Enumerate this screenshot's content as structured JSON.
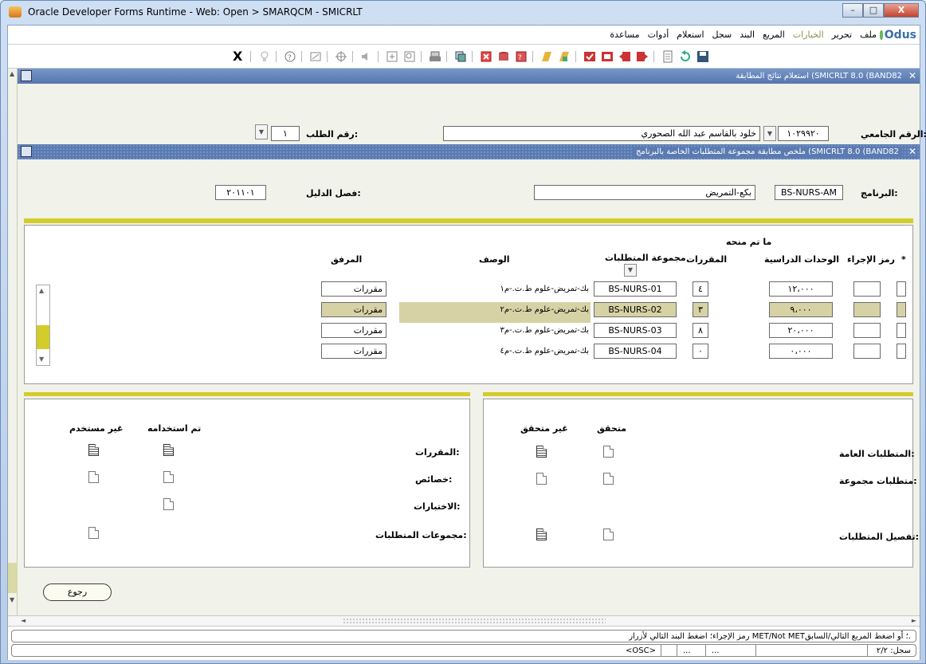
{
  "window": {
    "title": "Oracle Developer Forms Runtime - Web:  Open > SMARQCM - SMICRLT",
    "btn_min": "–",
    "btn_max": "□",
    "btn_close": "X"
  },
  "menu": [
    "ملف",
    "تحرير",
    "الخيارات",
    "المريع",
    "البند",
    "سجل",
    "استعلام",
    "أدوات",
    "مساعدة"
  ],
  "logo": "Odus",
  "toolbar_exit": "X",
  "section1": {
    "title": "استعلام نتائج المطابقة  (SMICRLT 8.0  (BAND82"
  },
  "key": {
    "student_id_label": "الرقم الجامعي:",
    "student_id": "١٠٢٩٩٢٠",
    "student_name": "خلود بالقاسم عبد الله الصحوري",
    "request_label": "رقم الطلب:",
    "request_no": "١"
  },
  "section2": {
    "title": "ملخص مطابقة مجموعة المتطلبات الخاصة بالبرنامج  (SMICRLT 8.0  (BAND82"
  },
  "program": {
    "label": "البرنامج:",
    "code": "BS-NURS-AM",
    "desc": "بكع-التمريض",
    "catalog_label": "فصل الدليل:",
    "catalog_term": "٢٠١١٠١"
  },
  "grid": {
    "headers": {
      "star": "*",
      "act_code": "رمز الإجراء",
      "granted": "ما تم منحه",
      "credits": "الوحدات الدراسية",
      "courses": "المقررات",
      "group": "مجموعة المتطلبات",
      "desc": "الوصف",
      "attach": "المرفق"
    },
    "rows": [
      {
        "credits": "١٢،٠٠٠",
        "courses": "٤",
        "group": "BS-NURS-01",
        "desc": "بك-تمريض-علوم ط.ت.-م١",
        "attach": "مقررات"
      },
      {
        "credits": "٩،٠٠٠",
        "courses": "٣",
        "group": "BS-NURS-02",
        "desc": "بك-تمريض-علوم ط.ت.-م٢",
        "attach": "مقررات"
      },
      {
        "credits": "٢٠،٠٠٠",
        "courses": "٨",
        "group": "BS-NURS-03",
        "desc": "بك-تمريض-علوم ط.ت.-م٣",
        "attach": "مقررات"
      },
      {
        "credits": "٠،٠٠٠",
        "courses": "٠",
        "group": "BS-NURS-04",
        "desc": "بك-تمريض-علوم ط.ت.-م٤",
        "attach": "مقررات"
      }
    ]
  },
  "right_panel": {
    "met": "متحقق",
    "not_met": "غير متحقق",
    "general": "المتطلبات العامة:",
    "group_req": "متطلبات مجموعة:",
    "detail": "تفصيل المتطلبات:"
  },
  "left_panel": {
    "used": "تم استخدامه",
    "unused": "غير مستخدم",
    "courses": "المقررات:",
    "attributes": "خصائص:",
    "tests": "الاختبارات:",
    "groups": "مجموعات المتطلبات:"
  },
  "back_button": "رجوع",
  "status": {
    "hint": "رمز الإجراء؛ اضغط البند التالي لأزرار MET/Not MET؛ أو اضغط المربع التالي/السابق.",
    "record": "سجل: ٢/٢",
    "osc": "<OSC>",
    "ell1": "...",
    "ell2": "..."
  }
}
